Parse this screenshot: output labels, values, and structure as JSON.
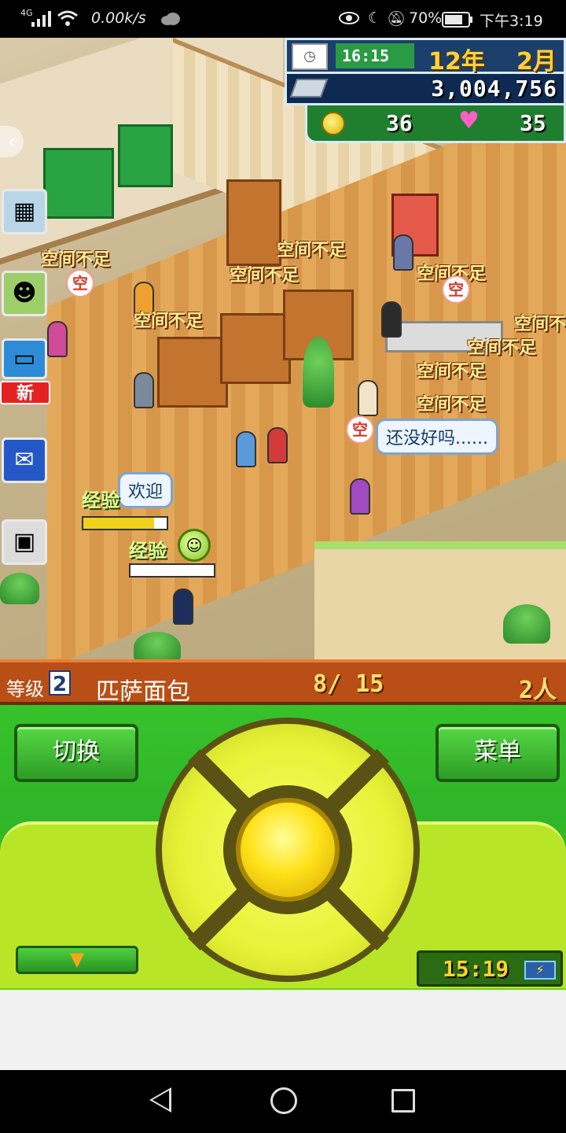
{
  "status_bar": {
    "network": "4G",
    "speed": "0.00k/s",
    "battery_percent": "70%",
    "clock": "下午3:19",
    "icons": [
      "signal-icon",
      "wifi-icon",
      "cloud-icon",
      "eye-icon",
      "moon-icon",
      "mute-bell-icon",
      "battery-icon"
    ]
  },
  "hud": {
    "game_time": "16:15",
    "year": "12年",
    "month": "2月",
    "money": "3,004,756",
    "coins": "36",
    "hearts": "35"
  },
  "sidebar": {
    "new_badge": "新",
    "items": [
      {
        "icon": "storage-box-icon"
      },
      {
        "icon": "staff-portrait-icon"
      },
      {
        "icon": "build-icon"
      },
      {
        "icon": "chat-message-icon"
      },
      {
        "icon": "computer-icon"
      }
    ]
  },
  "scene": {
    "warnings": [
      "空间不足",
      "空间不足",
      "空间不足",
      "空间不足",
      "空间不足",
      "空间不足",
      "空间不足",
      "空间不足",
      "空间不足"
    ],
    "speech_wait": "还没好吗......",
    "speech_welcome": "欢迎",
    "exp_label": "经验",
    "exp_fill": 0.85,
    "seat_badge": "空"
  },
  "info_bar": {
    "level_label": "等级",
    "level": "2",
    "shop_name": "匹萨面包",
    "capacity": "8/ 15",
    "staff": "2人"
  },
  "controller": {
    "switch_label": "切换",
    "menu_label": "菜单",
    "down_arrow": "▼",
    "clock": "15:19",
    "battery_glyph": "⚡"
  },
  "colors": {
    "info_bar": "#b94f16",
    "controller_green": "#37c22a",
    "dpad_yellow": "#ffe21a",
    "hud_navy": "#1b3e6b"
  }
}
